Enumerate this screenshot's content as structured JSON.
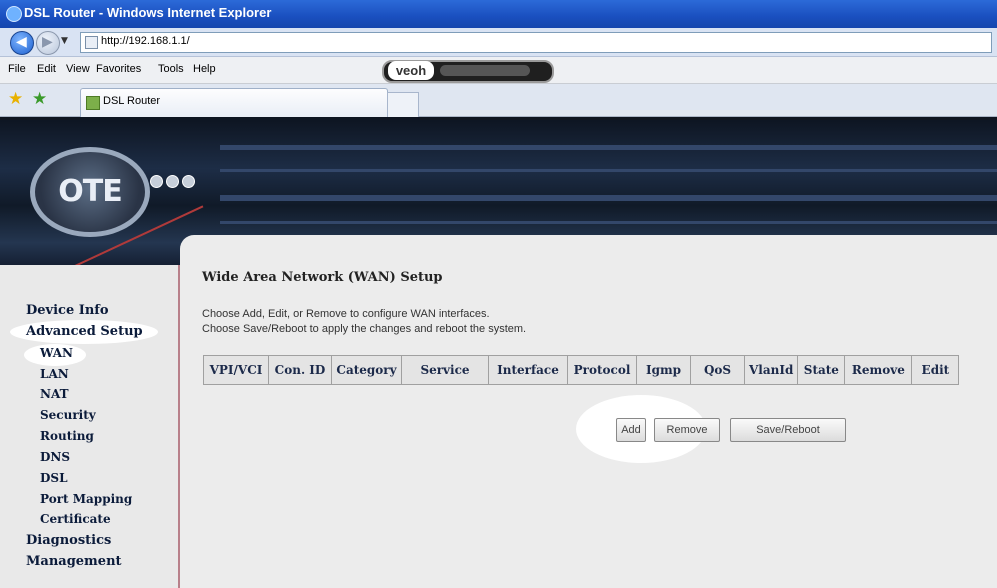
{
  "window": {
    "title": "DSL Router - Windows Internet Explorer"
  },
  "address": {
    "url": "http://192.168.1.1/"
  },
  "menu": [
    "File",
    "Edit",
    "View",
    "Favorites",
    "Tools",
    "Help"
  ],
  "toolbar": {
    "veoh_logo": "veoh"
  },
  "tab": {
    "label": "DSL Router"
  },
  "router": {
    "logo": "OTE",
    "nav": {
      "device_info": "Device Info",
      "advanced_setup": "Advanced Setup",
      "sub": [
        "WAN",
        "LAN",
        "NAT",
        "Security",
        "Routing",
        "DNS",
        "DSL",
        "Port Mapping",
        "Certificate"
      ],
      "diagnostics": "Diagnostics",
      "management": "Management"
    },
    "heading": "Wide Area Network (WAN) Setup",
    "desc1": "Choose Add, Edit, or Remove to configure WAN interfaces.",
    "desc2": "Choose Save/Reboot to apply the changes and reboot the system.",
    "table_headers": [
      "VPI/VCI",
      "Con. ID",
      "Category",
      "Service",
      "Interface",
      "Protocol",
      "Igmp",
      "QoS",
      "VlanId",
      "State",
      "Remove",
      "Edit"
    ],
    "buttons": {
      "add": "Add",
      "remove": "Remove",
      "save_reboot": "Save/Reboot"
    }
  },
  "colors": {
    "titlebar": "#1a4fbf",
    "sidebar_border": "#b8808a",
    "content_bg": "#ececec"
  }
}
